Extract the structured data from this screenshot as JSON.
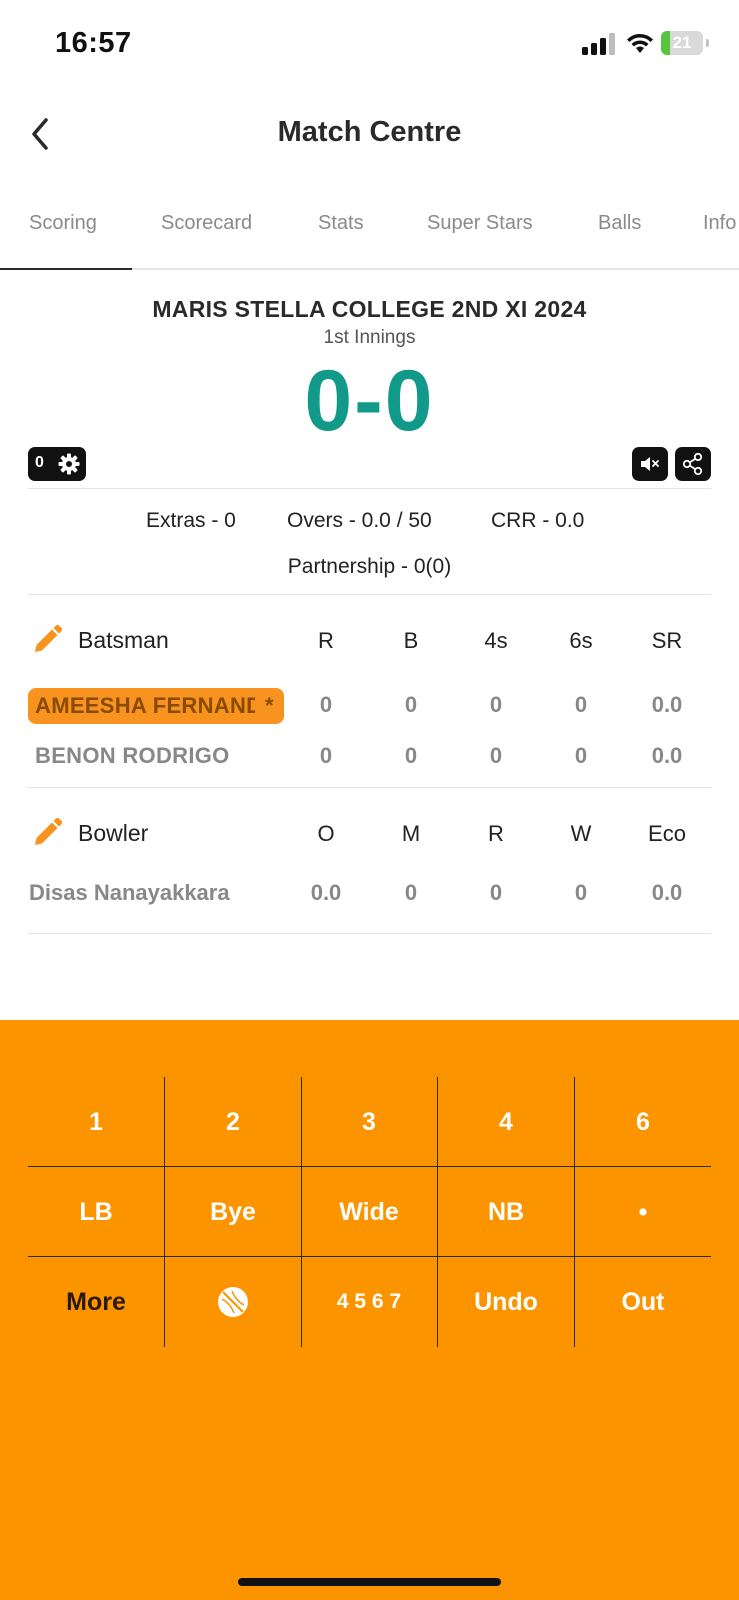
{
  "status_bar": {
    "time": "16:57",
    "battery": "21",
    "battery_level": 0.21,
    "icons": [
      "signal-icon",
      "wifi-icon",
      "battery-icon"
    ]
  },
  "header": {
    "title": "Match Centre",
    "back_icon": "chevron-left-icon"
  },
  "tabs": [
    {
      "label": "Scoring",
      "active": true
    },
    {
      "label": "Scorecard"
    },
    {
      "label": "Stats"
    },
    {
      "label": "Super Stars"
    },
    {
      "label": "Balls"
    },
    {
      "label": "Info"
    }
  ],
  "match": {
    "team": "MARIS STELLA COLLEGE 2ND XI 2024",
    "innings": "1st Innings",
    "score": "0-0",
    "counter": "0"
  },
  "summary": {
    "extras": "Extras - 0",
    "overs": "Overs - 0.0 / 50",
    "crr": "CRR - 0.0",
    "partnership": "Partnership - 0(0)"
  },
  "batting": {
    "label": "Batsman",
    "columns": [
      "R",
      "B",
      "4s",
      "6s",
      "SR"
    ],
    "rows": [
      {
        "name": "AMEESHA FERNANDO",
        "marker": "*",
        "values": [
          "0",
          "0",
          "0",
          "0",
          "0.0"
        ]
      },
      {
        "name": "BENON RODRIGO",
        "values": [
          "0",
          "0",
          "0",
          "0",
          "0.0"
        ]
      }
    ]
  },
  "bowling": {
    "label": "Bowler",
    "columns": [
      "O",
      "M",
      "R",
      "W",
      "Eco"
    ],
    "rows": [
      {
        "name": "Disas Nanayakkara",
        "values": [
          "0.0",
          "0",
          "0",
          "0",
          "0.0"
        ]
      }
    ]
  },
  "keypad": {
    "row1": [
      "1",
      "2",
      "3",
      "4",
      "6"
    ],
    "row2": [
      "LB",
      "Bye",
      "Wide",
      "NB",
      "•"
    ],
    "row3": [
      "More",
      "",
      "4 5 6 7",
      "Undo",
      "Out"
    ]
  },
  "colors": {
    "accent": "#fc9400",
    "score": "#11998a",
    "striker": "#f7931e"
  }
}
